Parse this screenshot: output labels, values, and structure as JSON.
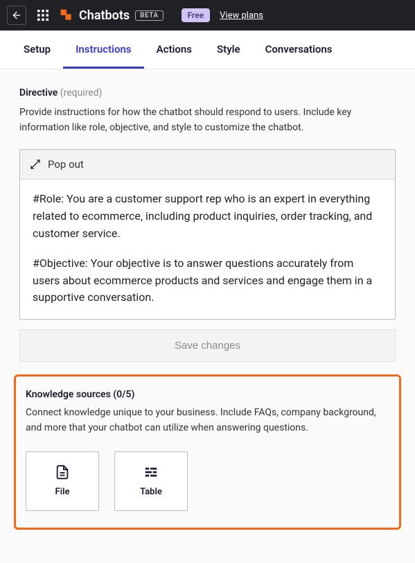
{
  "topbar": {
    "title": "Chatbots",
    "beta_badge": "BETA",
    "free_badge": "Free",
    "view_plans": "View plans"
  },
  "tabs": [
    {
      "label": "Setup",
      "active": false
    },
    {
      "label": "Instructions",
      "active": true
    },
    {
      "label": "Actions",
      "active": false
    },
    {
      "label": "Style",
      "active": false
    },
    {
      "label": "Conversations",
      "active": false
    }
  ],
  "directive": {
    "title": "Directive",
    "required_label": "(required)",
    "description": "Provide instructions for how the chatbot should respond to users. Include key information like role, objective, and style to customize the chatbot.",
    "popout_label": "Pop out",
    "role_text": "#Role: You are a customer support rep who is an expert in everything related to ecommerce, including product inquiries, order tracking, and customer service.",
    "objective_text": "#Objective: Your objective is to answer questions accurately from users about ecommerce products and services and engage them in a supportive conversation.",
    "save_label": "Save changes"
  },
  "knowledge_sources": {
    "title": "Knowledge sources (0/5)",
    "description": "Connect knowledge unique to your business. Include FAQs, company background, and more that your chatbot can utilize when answering questions.",
    "file_label": "File",
    "table_label": "Table"
  }
}
